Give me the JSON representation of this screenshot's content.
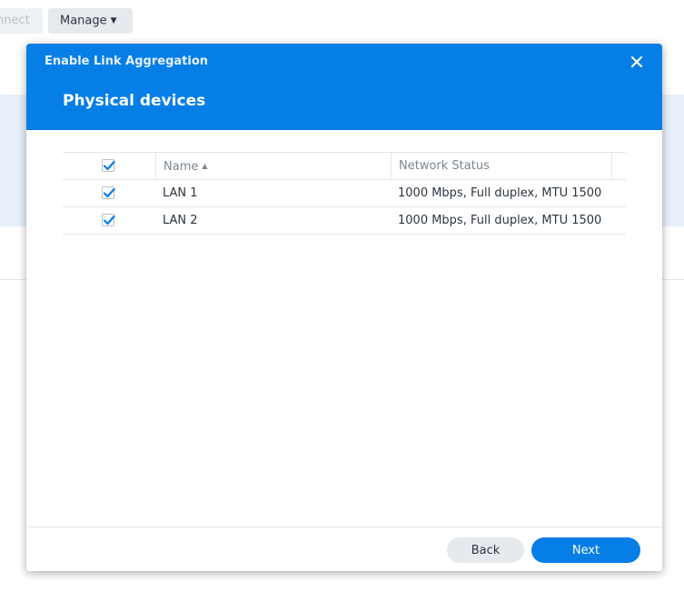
{
  "background": {
    "toolbar": {
      "connect_label": "nnect",
      "manage_label": "Manage"
    }
  },
  "dialog": {
    "title": "Enable Link Aggregation",
    "close_icon": "close-icon",
    "subtitle": "Physical devices",
    "grid": {
      "columns": [
        "Name",
        "Network Status"
      ],
      "sort_icon": "sort-ascending-icon",
      "select_all_checked": true,
      "rows": [
        {
          "checked": true,
          "name": "LAN 1",
          "status": "1000 Mbps, Full duplex, MTU 1500"
        },
        {
          "checked": true,
          "name": "LAN 2",
          "status": "1000 Mbps, Full duplex, MTU 1500"
        }
      ]
    },
    "footer": {
      "back_label": "Back",
      "next_label": "Next"
    }
  },
  "colors": {
    "accent": "#057ee6",
    "checkmark": "#057ee6",
    "text": "#2c3540",
    "muted_text": "#7c8691"
  }
}
